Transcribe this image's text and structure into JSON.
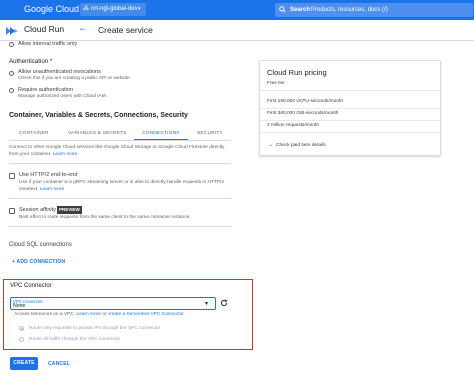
{
  "topbar": {
    "brand": "Google Cloud",
    "project": "nrt-ngl-global-dev",
    "search_label": "Search",
    "search_placeholder": "Products, resources, docs (/)"
  },
  "service_bar": {
    "product": "Cloud Run",
    "page_title": "Create service"
  },
  "ingress": {
    "internal_option": "Allow internal traffic only"
  },
  "authentication": {
    "heading": "Authentication *",
    "options": [
      {
        "label": "Allow unauthenticated invocations",
        "desc": "Check this if you are creating a public API or website."
      },
      {
        "label": "Require authentication",
        "desc": "Manage authorized users with Cloud IAM."
      }
    ]
  },
  "advanced": {
    "heading": "Container, Variables & Secrets, Connections, Security",
    "tabs": [
      "CONTAINER",
      "VARIABLES & SECRETS",
      "CONNECTIONS",
      "SECURITY"
    ],
    "active_tab": "CONNECTIONS"
  },
  "connections": {
    "intro_line1": "Connect to other Google Cloud services like Google Cloud Storage or Google Cloud Firestore directly",
    "intro_line2": "from your container.",
    "intro_link": "Learn more",
    "http2": {
      "label": "Use HTTP/2 end-to-end",
      "desc1": "Use if your container  is a gRPC streaming server or is able to directly handle requests in HTTP/2",
      "desc2": "cleartext.",
      "link": "Learn more"
    },
    "session_affinity": {
      "label": "Session affinity",
      "badge": "PREVIEW",
      "desc": "Best effort to route requests from the same client to the same container instance."
    },
    "cloud_sql": {
      "label": "Cloud SQL connections",
      "add_button": "+ ADD CONNECTION"
    },
    "vpc": {
      "heading": "VPC Connector",
      "field_label": "VPC Connector",
      "value": "None",
      "help_prefix": "Access resources on a VPC.",
      "help_link1": "Learn more",
      "help_mid": "or",
      "help_link2": "create a Serverless VPC Connector",
      "route_options": [
        "Route only requests to private IPs through the VPC connector",
        "Route all traffic through the VPC connector"
      ]
    }
  },
  "pricing": {
    "title": "Cloud Run pricing",
    "tier": "Free tier",
    "items": [
      "First 180,000 vCPU-seconds/month",
      "First 360,000 GiB-seconds/month",
      "2 million requests/month"
    ],
    "link": "Check paid tiers details"
  },
  "actions": {
    "create": "CREATE",
    "cancel": "CANCEL"
  },
  "colors": {
    "primary": "#1a73e8",
    "highlight_box": "#d93025"
  }
}
